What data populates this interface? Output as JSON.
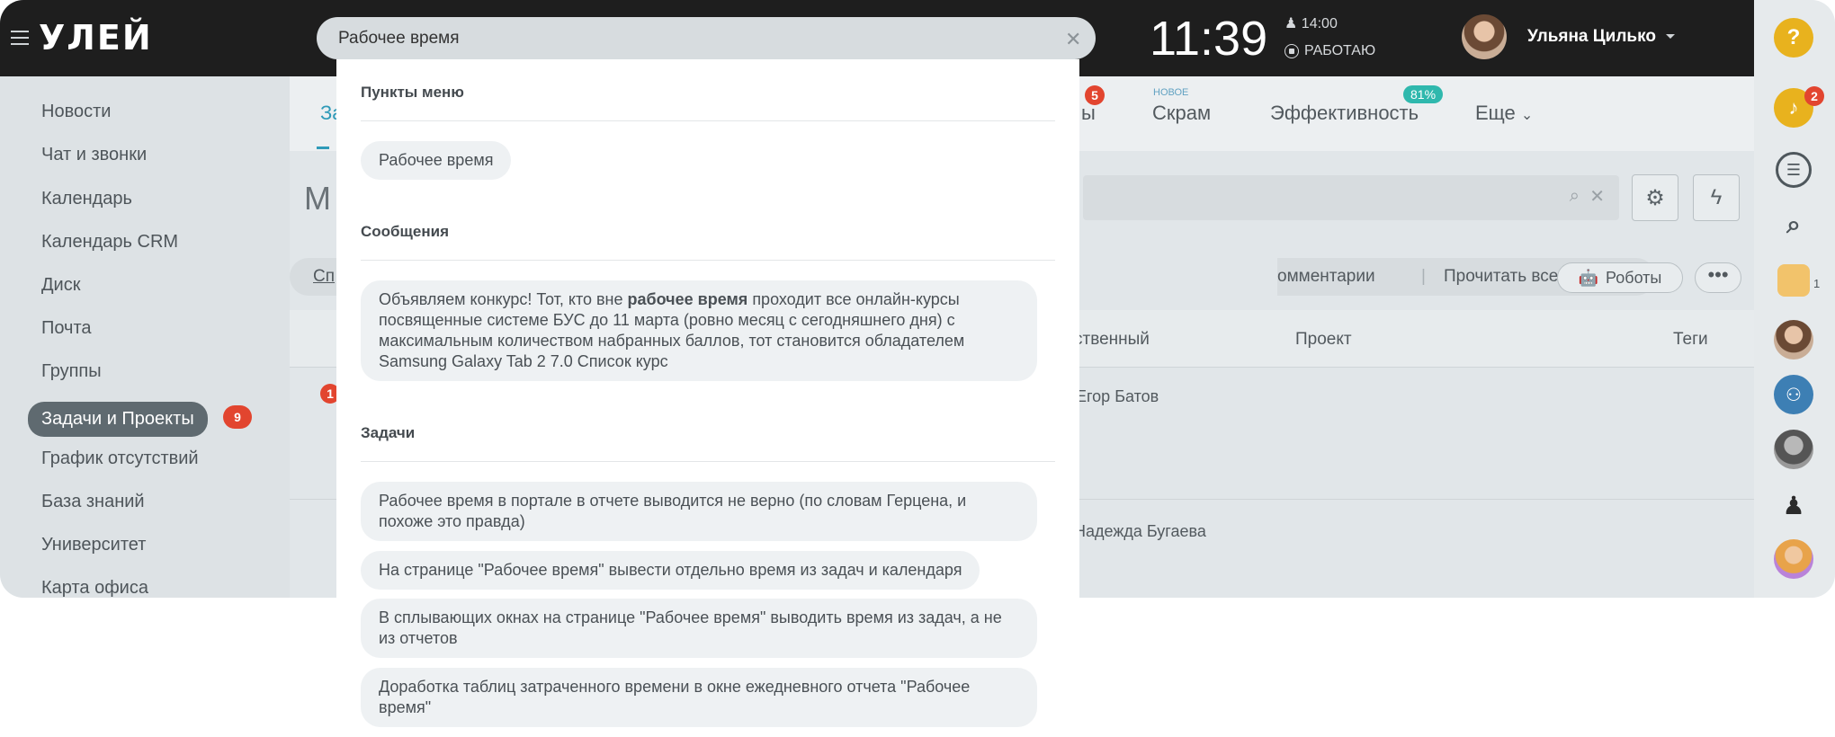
{
  "header": {
    "logo": "УЛЕЙ",
    "search_value": "Рабочее время",
    "clock": "11:39",
    "worktime": "14:00",
    "status": "РАБОТАЮ",
    "user_name": "Ульяна Цилько"
  },
  "sidebar": {
    "items": [
      {
        "label": "Новости"
      },
      {
        "label": "Чат и звонки"
      },
      {
        "label": "Календарь"
      },
      {
        "label": "Календарь CRM"
      },
      {
        "label": "Диск"
      },
      {
        "label": "Почта"
      },
      {
        "label": "Группы"
      },
      {
        "label": "Задачи и Проекты",
        "badge": "9"
      },
      {
        "label": "График отсутствий"
      },
      {
        "label": "База знаний"
      },
      {
        "label": "Университет"
      },
      {
        "label": "Карта офиса"
      }
    ]
  },
  "main": {
    "tab_partial_first": "За",
    "tab_partial_badge": "5",
    "tab_partial_suffix": "ы",
    "tab_scrum_new": "НОВОЕ",
    "tab_scrum": "Скрам",
    "tab_efficiency": "Эффективность",
    "tab_efficiency_badge": "81%",
    "tab_more": "Еще",
    "title_partial": "М",
    "filter_partial": "Сп",
    "comments_partial": "омментарии",
    "read_all": "Прочитать все",
    "robots": "Роботы",
    "col_responsible_partial": "ственный",
    "col_project": "Проект",
    "col_tags": "Теги",
    "row1_counter": "1",
    "row1_person_partial": "Егор Батов",
    "row2_person_partial": "Надежда Бугаева"
  },
  "rail": {
    "help": "?",
    "notifications_badge": "2",
    "cart_count": "1"
  },
  "dropdown": {
    "sections": {
      "menu_title": "Пункты меню",
      "menu_item": "Рабочее время",
      "messages_title": "Сообщения",
      "message_before": "Объявляем конкурс! Тот, кто вне ",
      "message_bold": "рабочее время",
      "message_after": " проходит все онлайн-курсы посвященные системе БУС до 11 марта (ровно месяц с сегодняшнего дня) с максимальным количеством набранных баллов, тот становится обладателем Samsung Galaxy Tab 2 7.0 Список курс",
      "tasks_title": "Задачи",
      "tasks": [
        "Рабочее время в портале в отчете выводится не верно (по словам Герцена, и похоже это правда)",
        "На странице \"Рабочее время\" вывести отдельно время из задач и календаря",
        "В сплывающих окнах на странице \"Рабочее время\" выводить время из задач, а не из отчетов",
        "Доработка таблиц затраченного времени в окне ежедневного отчета \"Рабочее время\""
      ]
    }
  },
  "colors": {
    "header_bg": "#1e1e1e",
    "accent_red": "#e2452f",
    "accent_teal": "#2fb8ad",
    "help_yellow": "#e8b21e"
  }
}
